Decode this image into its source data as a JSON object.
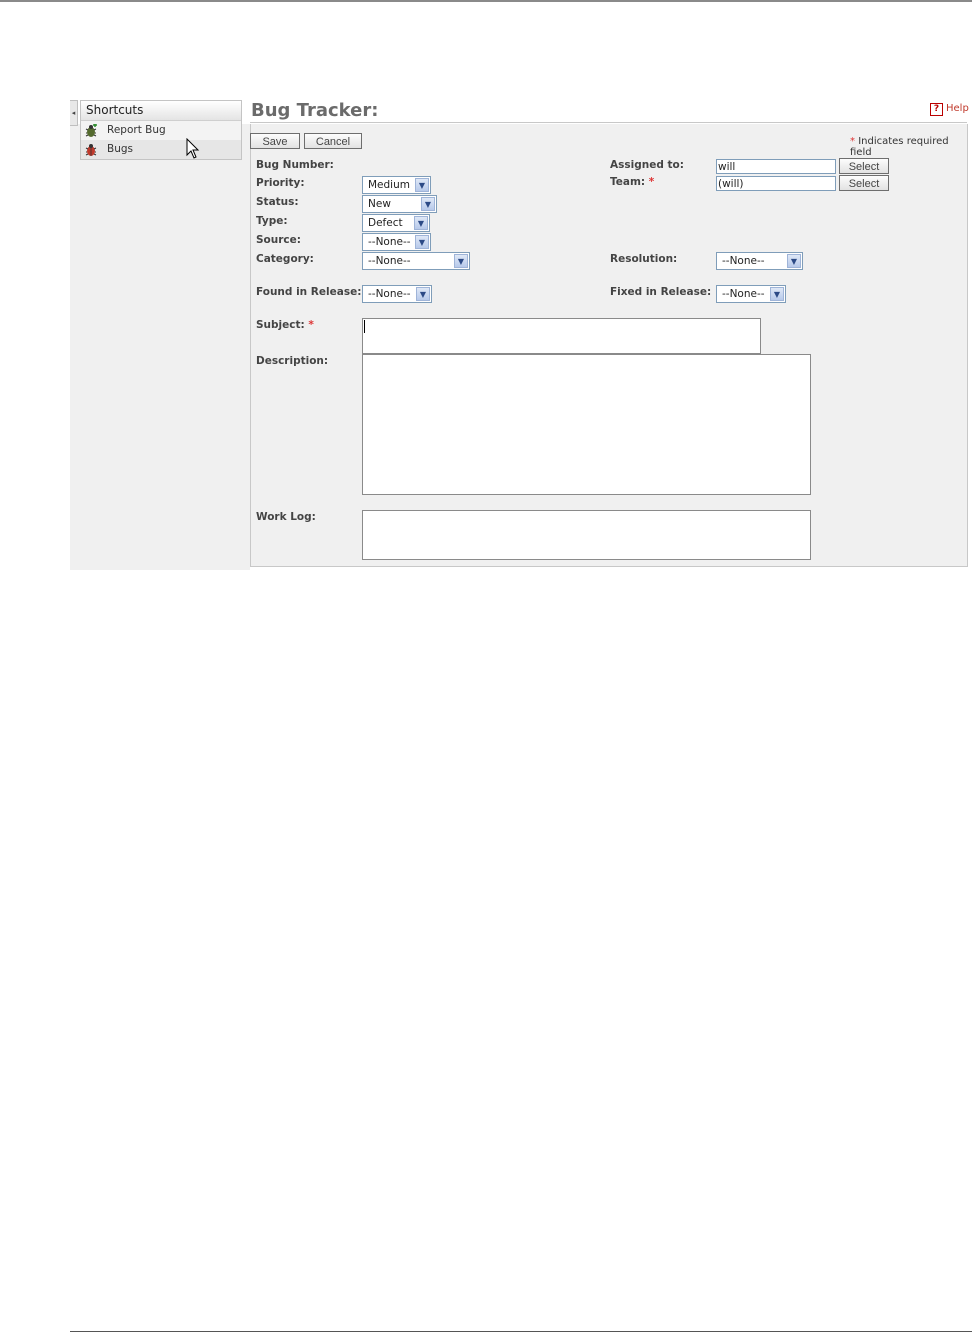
{
  "sidebar": {
    "collapse_glyph": "◂",
    "title": "Shortcuts",
    "items": [
      {
        "label": "Report Bug",
        "icon": "bug-add-icon"
      },
      {
        "label": "Bugs",
        "icon": "bug-icon"
      }
    ]
  },
  "header": {
    "title": "Bug Tracker:",
    "help_label": "Help",
    "help_icon_glyph": "?"
  },
  "toolbar": {
    "save_label": "Save",
    "cancel_label": "Cancel",
    "required_star": "*",
    "required_note": "Indicates required field"
  },
  "form": {
    "bug_number_label": "Bug Number:",
    "priority_label": "Priority:",
    "priority_value": "Medium",
    "status_label": "Status:",
    "status_value": "New",
    "type_label": "Type:",
    "type_value": "Defect",
    "source_label": "Source:",
    "source_value": "--None--",
    "category_label": "Category:",
    "category_value": "--None--",
    "found_in_release_label": "Found in Release:",
    "found_in_release_value": "--None--",
    "assigned_to_label": "Assigned to:",
    "assigned_to_value": "will",
    "team_label": "Team:",
    "team_value": "(will)",
    "select_label": "Select",
    "resolution_label": "Resolution:",
    "resolution_value": "--None--",
    "fixed_in_release_label": "Fixed in Release:",
    "fixed_in_release_value": "--None--",
    "subject_label": "Subject:",
    "subject_value": "",
    "description_label": "Description:",
    "description_value": "",
    "work_log_label": "Work Log:",
    "work_log_value": ""
  },
  "colors": {
    "required": "#dd3333",
    "help": "#c0392b",
    "title": "#6b6b6b",
    "panel_bg": "#f0f0f0"
  }
}
